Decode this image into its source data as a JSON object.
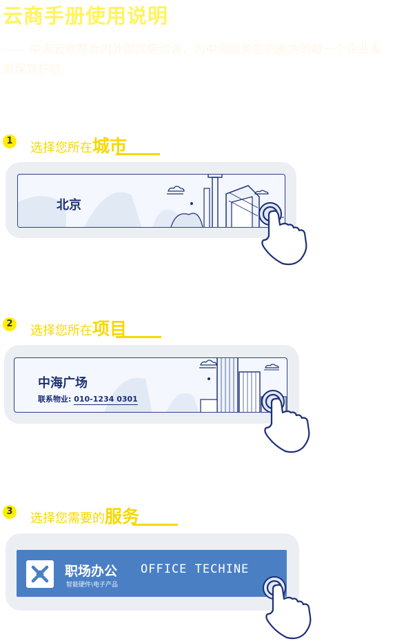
{
  "header": {
    "title": "云商手册使用说明",
    "subtitle": "—— 中海云商整合内外部优势资源，为中海商务生态圈内的每一个企业发展保驾护航。"
  },
  "steps": [
    {
      "num": "1",
      "text": "选择您所在",
      "emphasis": "城市"
    },
    {
      "num": "2",
      "text": "选择您所在",
      "emphasis": "项目"
    },
    {
      "num": "3",
      "text": "选择您需要的",
      "emphasis": "服务"
    }
  ],
  "city_card": {
    "city": "北京"
  },
  "project_card": {
    "name": "中海广场",
    "phone_label": "联系物业:",
    "phone": "010-1234 0301"
  },
  "service_card": {
    "name_cn": "职场办公",
    "name_en": "OFFICE TECHINE",
    "subtitle": "智能硬件\\电子产品"
  },
  "colors": {
    "accent_yellow": "#f7d800",
    "navy": "#1c2f74",
    "service_blue": "#4a7fc4"
  },
  "icons": [
    "pointing-hand-icon",
    "cloud-icon",
    "building-illustration",
    "office-logo-icon"
  ]
}
